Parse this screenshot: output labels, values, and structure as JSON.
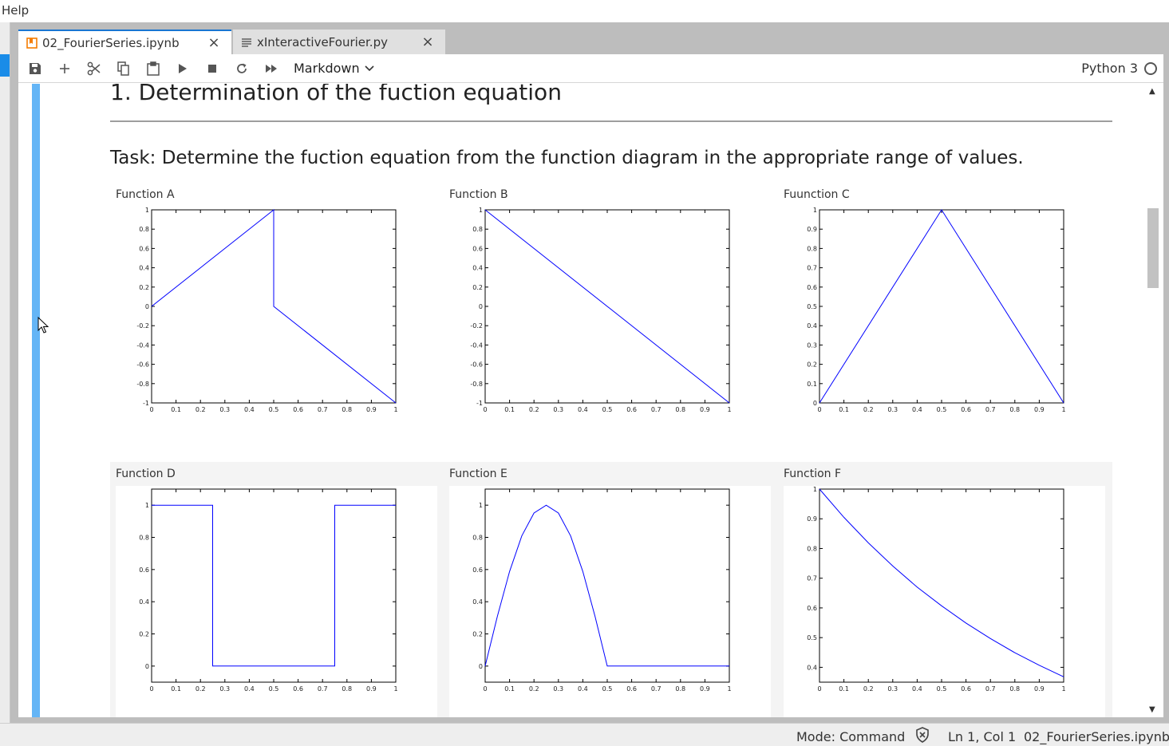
{
  "menu": {
    "help_label": "Help"
  },
  "tabs": [
    {
      "label": "02_FourierSeries.ipynb",
      "close": "×",
      "icon": "notebook-icon"
    },
    {
      "label": "xInteractiveFourier.py",
      "close": "×",
      "icon": "text-file-icon"
    }
  ],
  "toolbar": {
    "buttons": [
      "save-icon",
      "add-cell-icon",
      "cut-icon",
      "copy-icon",
      "paste-icon",
      "run-icon",
      "stop-icon",
      "restart-icon",
      "fast-forward-icon"
    ],
    "cell_type": "Markdown",
    "kernel": "Python 3"
  },
  "notebook": {
    "heading": "1. Determination of the fuction equation",
    "task": "Task: Determine the fuction equation from the function diagram in the appropriate range of values."
  },
  "statusbar": {
    "mode": "Mode: Command",
    "position": "Ln 1, Col 1",
    "filename": "02_FourierSeries.ipynb"
  },
  "colors": {
    "accent": "#1976d2",
    "collapser": "#64b5f6",
    "line": "#0000ff"
  },
  "chart_data": [
    {
      "type": "line",
      "title": "Function A",
      "xlim": [
        0,
        1
      ],
      "ylim": [
        -1,
        1
      ],
      "x_ticks": [
        "0",
        "0.1",
        "0.2",
        "0.3",
        "0.4",
        "0.5",
        "0.6",
        "0.7",
        "0.8",
        "0.9",
        "1"
      ],
      "y_ticks": [
        "-1",
        "-0.8",
        "-0.6",
        "-0.4",
        "-0.2",
        "0",
        "0.2",
        "0.4",
        "0.6",
        "0.8",
        "1"
      ],
      "series": [
        {
          "x": [
            0,
            0.5,
            0.5,
            1
          ],
          "y": [
            0,
            1,
            0,
            -1
          ]
        }
      ]
    },
    {
      "type": "line",
      "title": "Function B",
      "xlim": [
        0,
        1
      ],
      "ylim": [
        -1,
        1
      ],
      "x_ticks": [
        "0",
        "0.1",
        "0.2",
        "0.3",
        "0.4",
        "0.5",
        "0.6",
        "0.7",
        "0.8",
        "0.9",
        "1"
      ],
      "y_ticks": [
        "-1",
        "-0.8",
        "-0.6",
        "-0.4",
        "-0.2",
        "0",
        "0.2",
        "0.4",
        "0.6",
        "0.8",
        "1"
      ],
      "series": [
        {
          "x": [
            0,
            1
          ],
          "y": [
            1,
            -1
          ]
        }
      ]
    },
    {
      "type": "line",
      "title": "Fuunction C",
      "xlim": [
        0,
        1
      ],
      "ylim": [
        0,
        1
      ],
      "x_ticks": [
        "0",
        "0.1",
        "0.2",
        "0.3",
        "0.4",
        "0.5",
        "0.6",
        "0.7",
        "0.8",
        "0.9",
        "1"
      ],
      "y_ticks": [
        "0",
        "0.1",
        "0.2",
        "0.3",
        "0.4",
        "0.5",
        "0.6",
        "0.7",
        "0.8",
        "0.9",
        "1"
      ],
      "series": [
        {
          "x": [
            0,
            0.5,
            1
          ],
          "y": [
            0,
            1,
            0
          ]
        }
      ]
    },
    {
      "type": "line",
      "title": "Function D",
      "xlim": [
        0,
        1
      ],
      "ylim": [
        -0.1,
        1.1
      ],
      "x_ticks": [
        "0",
        "0.1",
        "0.2",
        "0.3",
        "0.4",
        "0.5",
        "0.6",
        "0.7",
        "0.8",
        "0.9",
        "1"
      ],
      "y_ticks": [
        "0",
        "0.2",
        "0.4",
        "0.6",
        "0.8",
        "1"
      ],
      "series": [
        {
          "x": [
            0,
            0.25,
            0.25,
            0.75,
            0.75,
            1
          ],
          "y": [
            1,
            1,
            0,
            0,
            1,
            1
          ]
        }
      ]
    },
    {
      "type": "line",
      "title": "Function E",
      "xlim": [
        0,
        1
      ],
      "ylim": [
        -0.1,
        1.1
      ],
      "x_ticks": [
        "0",
        "0.1",
        "0.2",
        "0.3",
        "0.4",
        "0.5",
        "0.6",
        "0.7",
        "0.8",
        "0.9",
        "1"
      ],
      "y_ticks": [
        "0",
        "0.2",
        "0.4",
        "0.6",
        "0.8",
        "1"
      ],
      "series": [
        {
          "x": [
            0,
            0.05,
            0.1,
            0.15,
            0.2,
            0.25,
            0.3,
            0.35,
            0.4,
            0.45,
            0.5,
            0.6,
            0.7,
            0.8,
            0.9,
            1
          ],
          "y": [
            0,
            0.309,
            0.588,
            0.809,
            0.951,
            1,
            0.951,
            0.809,
            0.588,
            0.309,
            0,
            0,
            0,
            0,
            0,
            0
          ]
        }
      ]
    },
    {
      "type": "line",
      "title": "Function F",
      "xlim": [
        0,
        1
      ],
      "ylim": [
        0.35,
        1
      ],
      "x_ticks": [
        "0",
        "0.1",
        "0.2",
        "0.3",
        "0.4",
        "0.5",
        "0.6",
        "0.7",
        "0.8",
        "0.9",
        "1"
      ],
      "y_ticks": [
        "0.4",
        "0.5",
        "0.6",
        "0.7",
        "0.8",
        "0.9",
        "1"
      ],
      "series": [
        {
          "x": [
            0,
            0.1,
            0.2,
            0.3,
            0.4,
            0.5,
            0.6,
            0.7,
            0.8,
            0.9,
            1
          ],
          "y": [
            1,
            0.905,
            0.819,
            0.741,
            0.67,
            0.607,
            0.549,
            0.497,
            0.449,
            0.407,
            0.368
          ]
        }
      ]
    }
  ]
}
